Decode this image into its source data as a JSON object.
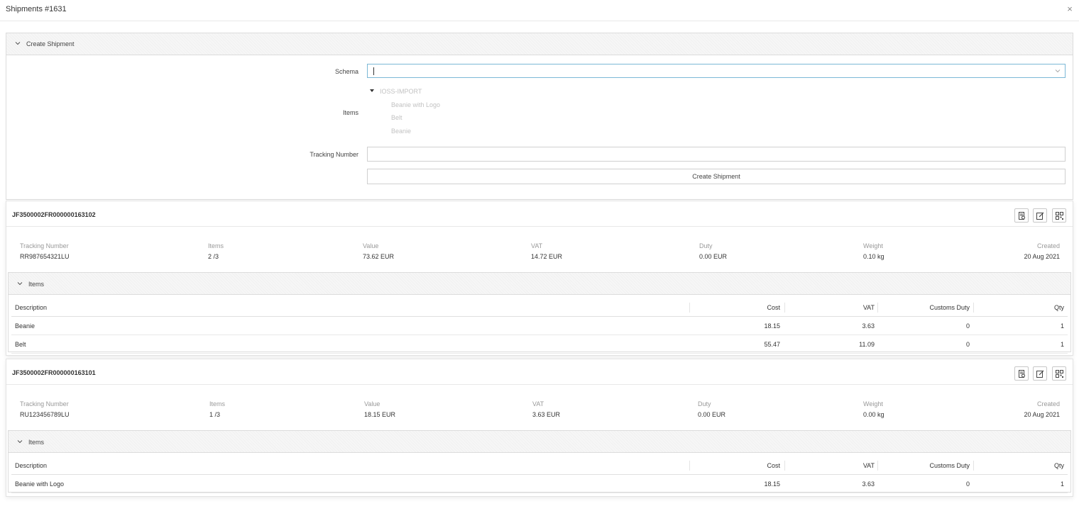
{
  "window": {
    "title": "Shipments #1631",
    "close_glyph": "×"
  },
  "create_panel": {
    "header": "Create Shipment",
    "schema_label": "Schema",
    "schema_value": "",
    "items_label": "Items",
    "tree": {
      "root": "IOSS-IMPORT",
      "children": [
        "Beanie with Logo",
        "Belt",
        "Beanie"
      ]
    },
    "tracking_label": "Tracking Number",
    "tracking_value": "",
    "submit_label": "Create Shipment"
  },
  "shipments": [
    {
      "code": "JF3500002FR000000163102",
      "facts": [
        {
          "label": "Tracking Number",
          "value": "RR987654321LU"
        },
        {
          "label": "Items",
          "value": "2 /3"
        },
        {
          "label": "Value",
          "value": "73.62 EUR"
        },
        {
          "label": "VAT",
          "value": "14.72 EUR"
        },
        {
          "label": "Duty",
          "value": "0.00 EUR"
        },
        {
          "label": "Weight",
          "value": "0.10 kg"
        },
        {
          "label": "Created",
          "value": "20 Aug 2021"
        }
      ],
      "items_header": "Items",
      "columns": [
        "Description",
        "Cost",
        "VAT",
        "Customs Duty",
        "Qty"
      ],
      "rows": [
        {
          "description": "Beanie",
          "cost": "18.15",
          "vat": "3.63",
          "duty": "0",
          "qty": "1"
        },
        {
          "description": "Belt",
          "cost": "55.47",
          "vat": "11.09",
          "duty": "0",
          "qty": "1"
        }
      ]
    },
    {
      "code": "JF3500002FR000000163101",
      "facts": [
        {
          "label": "Tracking Number",
          "value": "RU123456789LU"
        },
        {
          "label": "Items",
          "value": "1 /3"
        },
        {
          "label": "Value",
          "value": "18.15 EUR"
        },
        {
          "label": "VAT",
          "value": "3.63 EUR"
        },
        {
          "label": "Duty",
          "value": "0.00 EUR"
        },
        {
          "label": "Weight",
          "value": "0.00 kg"
        },
        {
          "label": "Created",
          "value": "20 Aug 2021"
        }
      ],
      "items_header": "Items",
      "columns": [
        "Description",
        "Cost",
        "VAT",
        "Customs Duty",
        "Qty"
      ],
      "rows": [
        {
          "description": "Beanie with Logo",
          "cost": "18.15",
          "vat": "3.63",
          "duty": "0",
          "qty": "1"
        }
      ]
    }
  ],
  "icons": {
    "collapse": "chevron-down-icon",
    "shipment_actions": [
      "label-document-icon",
      "edit-icon",
      "qr-code-icon"
    ]
  },
  "colors": {
    "focus_border": "#7bb8d6",
    "tree_disabled": "#c2c2c2"
  }
}
